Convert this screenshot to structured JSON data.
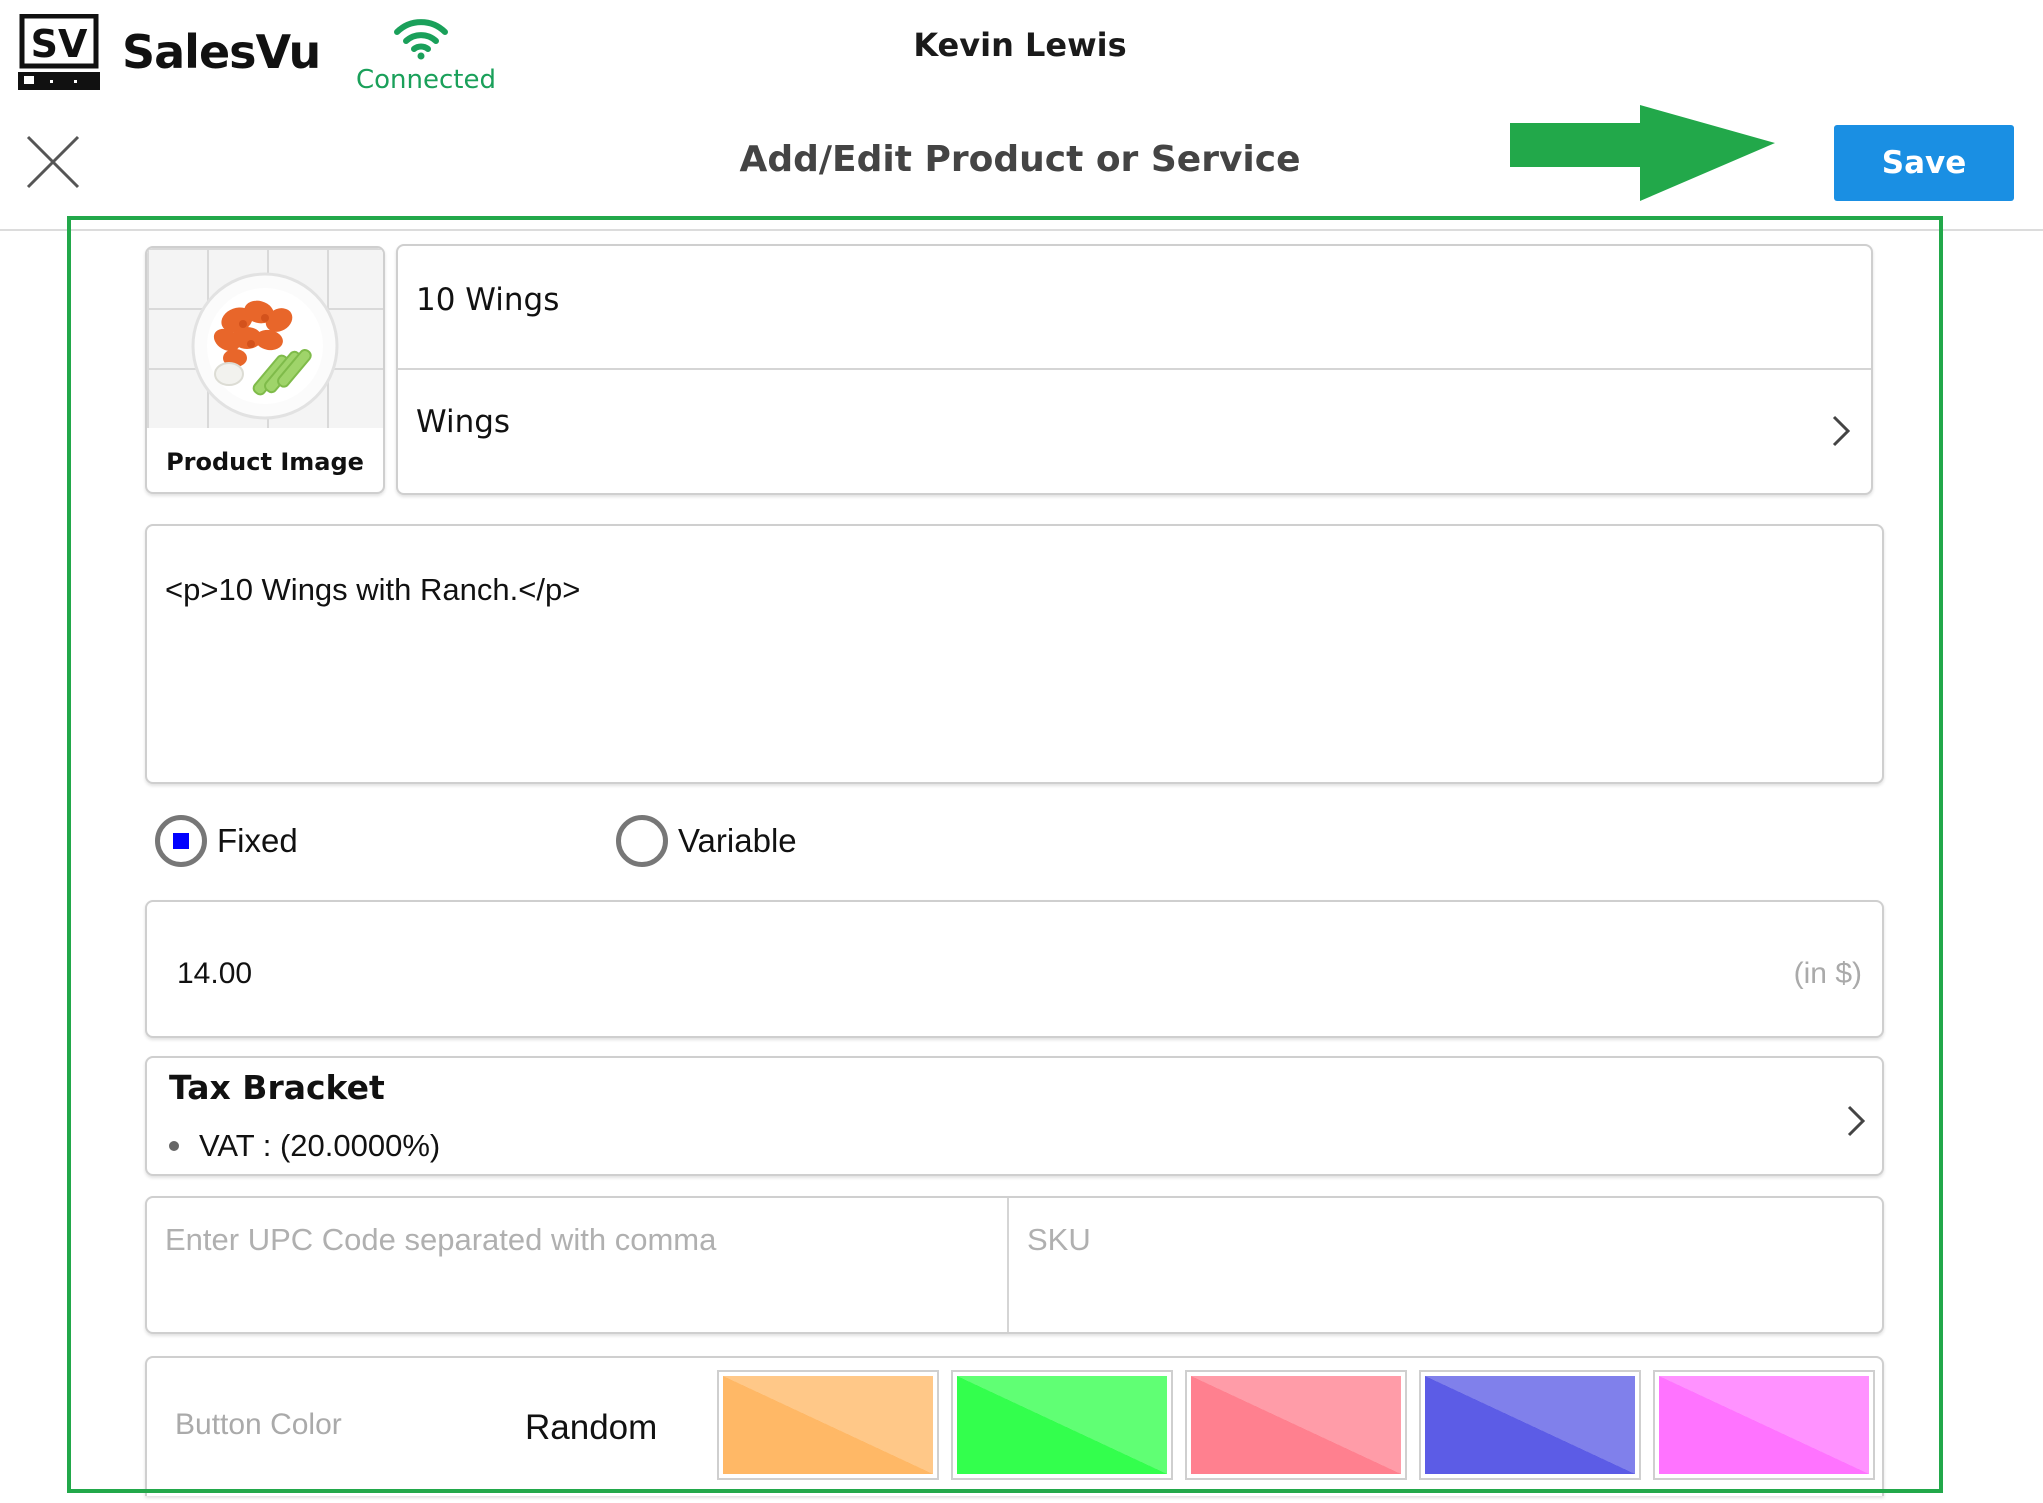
{
  "app": {
    "brand": "SalesVu",
    "logo_text": "SV",
    "connection_status": "Connected",
    "user_name": "Kevin Lewis"
  },
  "header": {
    "title": "Add/Edit Product or Service",
    "save_label": "Save",
    "close_icon": "close-icon"
  },
  "product": {
    "image_label": "Product Image",
    "name": "10 Wings",
    "category": "Wings",
    "description": "<p>10 Wings with Ranch.</p>"
  },
  "pricing": {
    "options": [
      {
        "label": "Fixed",
        "selected": true
      },
      {
        "label": "Variable",
        "selected": false
      }
    ],
    "price": "14.00",
    "unit": "(in $)"
  },
  "tax": {
    "title": "Tax Bracket",
    "items": [
      "VAT : (20.0000%)"
    ]
  },
  "codes": {
    "upc_placeholder": "Enter UPC Code separated with comma",
    "sku_placeholder": "SKU"
  },
  "button_color": {
    "label": "Button Color",
    "random_label": "Random",
    "swatches": [
      "#FFB866",
      "#33FF4D",
      "#FF808F",
      "#5C5CE6",
      "#FF73FF"
    ]
  },
  "colors": {
    "accent": "#1A8FE3",
    "connected": "#1AA05A",
    "highlight": "#22A84A",
    "radio_dot": "#0000FF"
  }
}
